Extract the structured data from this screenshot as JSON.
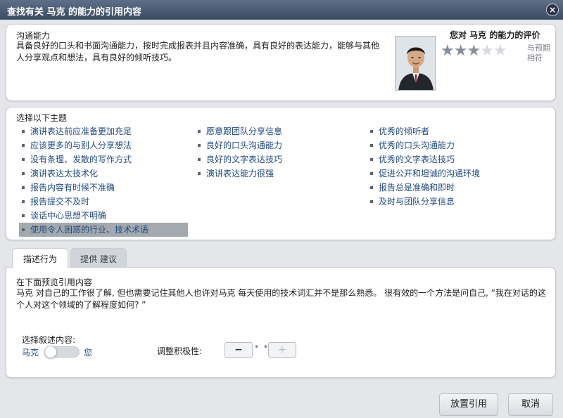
{
  "dialog": {
    "title": "查找有关 马克 的能力的引用内容",
    "close_symbol": "×"
  },
  "skill": {
    "name": "沟通能力",
    "description": "具备良好的口头和书面沟通能力，按时完成报表并且内容准确，具有良好的表达能力，能够与其他人分享观点和想法，具有良好的倾听技巧。"
  },
  "rating": {
    "title": "您对 马克 的能力的评价",
    "value": 3,
    "max": 5,
    "note": "与预期相符",
    "star_on_color": "#858d96",
    "star_off_color": "#d6d9dd"
  },
  "topics": {
    "title": "选择以下主题",
    "col1": [
      "演讲表达前应准备更加充足",
      "应该更多的与别人分享想法",
      "没有条理、发散的写作方式",
      "演讲表达太技术化",
      "报告内容有时候不准确",
      "报告提交不及时",
      "谈话中心思想不明确",
      "使用令人困惑的行业、技术术语"
    ],
    "col2": [
      "愿意跟团队分享信息",
      "良好的口头沟通能力",
      "良好的文字表达技巧",
      "演讲表达能力很强"
    ],
    "col3": [
      "优秀的倾听者",
      "优秀的口头沟通能力",
      "优秀的文字表达技巧",
      "促进公开和坦诚的沟通环境",
      "报告总是准确和即时",
      "及时与团队分享信息"
    ],
    "selected": "使用令人困惑的行业、技术术语"
  },
  "tabs": [
    {
      "label": "描述行为",
      "active": true
    },
    {
      "label": "提供 建议",
      "active": false
    }
  ],
  "preview": {
    "title": "在下面预览引用内容",
    "text": "马克 对自己的工作很了解, 但也需要记住其他人也许对马克 每天使用的技术词汇并不是那么熟悉。 很有效的一个方法是问自己, “我在对话的这个人对这个领域的了解程度如何? ”"
  },
  "narration": {
    "label": "选择叙述内容:",
    "left": "马克",
    "right": "您"
  },
  "adjust": {
    "label": "调整积极性:",
    "minus": "−",
    "plus": "+",
    "dots": "• • •"
  },
  "buttons": {
    "place": "放置引用",
    "cancel": "取消"
  }
}
